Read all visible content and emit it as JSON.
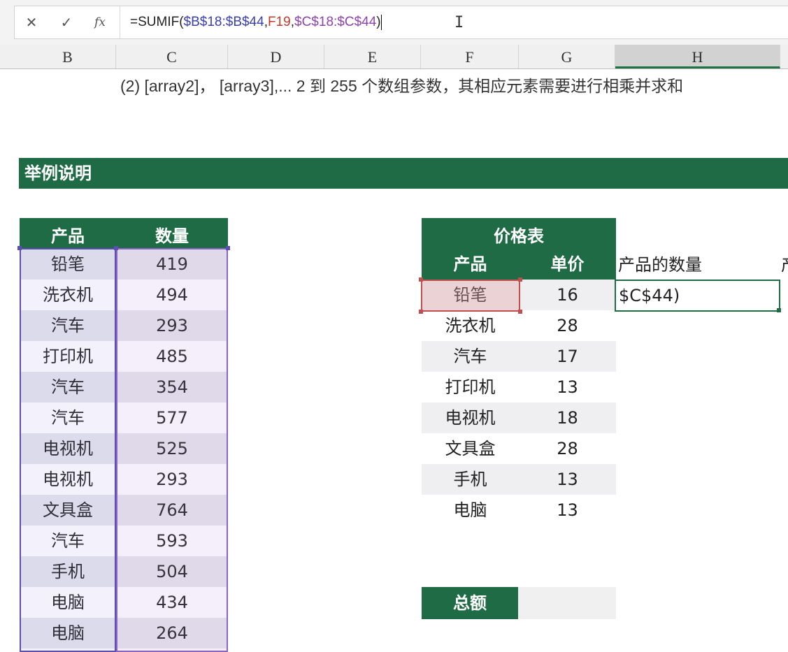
{
  "formula_bar": {
    "cancel_icon": "✕",
    "confirm_icon": "✓",
    "fx_icon": "fx",
    "parts": [
      "=SUMIF(",
      "$B$18:$B$44",
      ",",
      "F19",
      ",",
      "$C$18:$C$44",
      ")"
    ],
    "colors": {
      "default": "#222222",
      "range1": "#3b3fb0",
      "ref": "#c0392b",
      "range2": "#8e44ad"
    }
  },
  "columns": [
    "B",
    "C",
    "D",
    "E",
    "F",
    "G",
    "H"
  ],
  "selected_column": "H",
  "description": "(2) [array2]， [array3],...   2 到 255 个数组参数，其相应元素需要进行相乘并求和",
  "section_title": "举例说明",
  "left_table": {
    "headers": [
      "产品",
      "数量"
    ],
    "rows": [
      [
        "铅笔",
        "419"
      ],
      [
        "洗衣机",
        "494"
      ],
      [
        "汽车",
        "293"
      ],
      [
        "打印机",
        "485"
      ],
      [
        "汽车",
        "354"
      ],
      [
        "汽车",
        "577"
      ],
      [
        "电视机",
        "525"
      ],
      [
        "电视机",
        "293"
      ],
      [
        "文具盒",
        "764"
      ],
      [
        "汽车",
        "593"
      ],
      [
        "手机",
        "504"
      ],
      [
        "电脑",
        "434"
      ],
      [
        "电脑",
        "264"
      ]
    ]
  },
  "price_table": {
    "title": "价格表",
    "headers": [
      "产品",
      "单价"
    ],
    "rows": [
      [
        "铅笔",
        "16"
      ],
      [
        "洗衣机",
        "28"
      ],
      [
        "汽车",
        "17"
      ],
      [
        "打印机",
        "13"
      ],
      [
        "电视机",
        "18"
      ],
      [
        "文具盒",
        "28"
      ],
      [
        "手机",
        "13"
      ],
      [
        "电脑",
        "13"
      ]
    ]
  },
  "h_header": "产品的数量",
  "h_edge": "产",
  "active_cell_text": "$C$44)",
  "total_label": "总额",
  "colors": {
    "brand_green": "#1f6b45"
  }
}
